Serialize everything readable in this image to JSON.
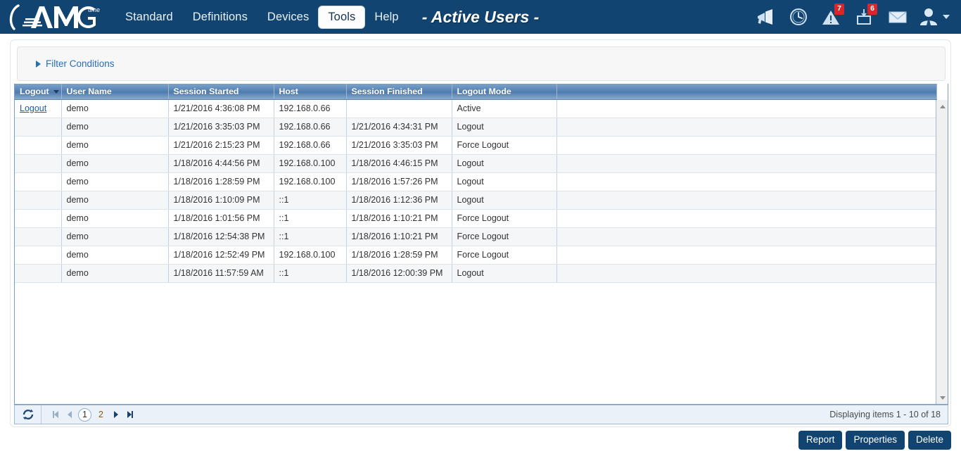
{
  "app": {
    "logo_text": "AMG",
    "logo_superscript": "time",
    "title": "- Active Users -"
  },
  "nav": {
    "items": [
      {
        "label": "Standard",
        "active": false
      },
      {
        "label": "Definitions",
        "active": false
      },
      {
        "label": "Devices",
        "active": false
      },
      {
        "label": "Tools",
        "active": true
      },
      {
        "label": "Help",
        "active": false
      }
    ]
  },
  "topicons": [
    {
      "name": "megaphone-icon",
      "badge": ""
    },
    {
      "name": "clock-icon",
      "badge": ""
    },
    {
      "name": "warning-icon",
      "badge": "7"
    },
    {
      "name": "inbox-icon",
      "badge": "6"
    },
    {
      "name": "envelope-icon",
      "badge": ""
    }
  ],
  "filter": {
    "label": "Filter Conditions",
    "expanded": false
  },
  "grid": {
    "columns": [
      "Logout",
      "User Name",
      "Session Started",
      "Host",
      "Session Finished",
      "Logout Mode"
    ],
    "sorted_column": "Logout",
    "rows": [
      {
        "logout": "Logout",
        "user": "demo",
        "started": "1/21/2016 4:36:08 PM",
        "host": "192.168.0.66",
        "finished": "",
        "mode": "Active"
      },
      {
        "logout": "",
        "user": "demo",
        "started": "1/21/2016 3:35:03 PM",
        "host": "192.168.0.66",
        "finished": "1/21/2016 4:34:31 PM",
        "mode": "Logout"
      },
      {
        "logout": "",
        "user": "demo",
        "started": "1/21/2016 2:15:23 PM",
        "host": "192.168.0.66",
        "finished": "1/21/2016 3:35:03 PM",
        "mode": "Force Logout"
      },
      {
        "logout": "",
        "user": "demo",
        "started": "1/18/2016 4:44:56 PM",
        "host": "192.168.0.100",
        "finished": "1/18/2016 4:46:15 PM",
        "mode": "Logout"
      },
      {
        "logout": "",
        "user": "demo",
        "started": "1/18/2016 1:28:59 PM",
        "host": "192.168.0.100",
        "finished": "1/18/2016 1:57:26 PM",
        "mode": "Logout"
      },
      {
        "logout": "",
        "user": "demo",
        "started": "1/18/2016 1:10:09 PM",
        "host": "::1",
        "finished": "1/18/2016 1:12:36 PM",
        "mode": "Logout"
      },
      {
        "logout": "",
        "user": "demo",
        "started": "1/18/2016 1:01:56 PM",
        "host": "::1",
        "finished": "1/18/2016 1:10:21 PM",
        "mode": "Force Logout"
      },
      {
        "logout": "",
        "user": "demo",
        "started": "1/18/2016 12:54:38 PM",
        "host": "::1",
        "finished": "1/18/2016 1:10:21 PM",
        "mode": "Force Logout"
      },
      {
        "logout": "",
        "user": "demo",
        "started": "1/18/2016 12:52:49 PM",
        "host": "192.168.0.100",
        "finished": "1/18/2016 1:28:59 PM",
        "mode": "Force Logout"
      },
      {
        "logout": "",
        "user": "demo",
        "started": "1/18/2016 11:57:59 AM",
        "host": "::1",
        "finished": "1/18/2016 12:00:39 PM",
        "mode": "Logout"
      }
    ]
  },
  "pager": {
    "refresh_icon": "refresh-icon",
    "pages": [
      "1",
      "2"
    ],
    "current_page": "1",
    "status": "Displaying items 1 - 10 of 18"
  },
  "actions": {
    "report": "Report",
    "properties": "Properties",
    "delete": "Delete"
  },
  "colors": {
    "brand_blue": "#114470",
    "header_grad_light": "#7da3ca",
    "header_grad_dark": "#4f7cae",
    "badge_red": "#d8262c",
    "link_blue": "#2657a8",
    "filter_link": "#2a6db5"
  }
}
